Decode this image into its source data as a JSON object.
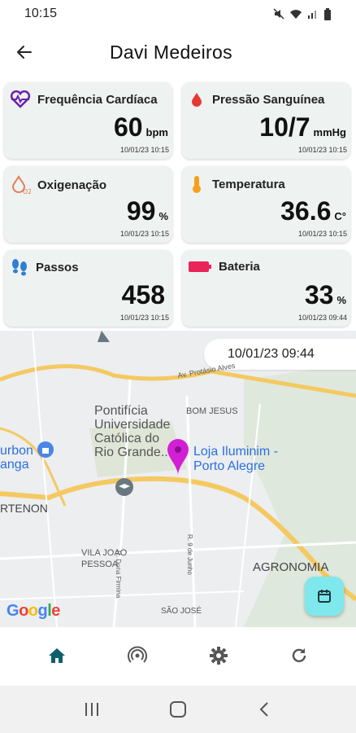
{
  "status_bar": {
    "time": "10:15"
  },
  "header": {
    "title": "Davi Medeiros"
  },
  "cards": [
    {
      "label": "Frequência Cardíaca",
      "value": "60",
      "unit": "bpm",
      "timestamp": "10/01/23 10:15",
      "icon": "heart-pulse-icon",
      "icon_color": "#6a1fb0"
    },
    {
      "label": "Pressão Sanguínea",
      "value": "10/7",
      "unit": "mmHg",
      "timestamp": "10/01/23 10:15",
      "icon": "blood-drop-icon",
      "icon_color": "#e53935"
    },
    {
      "label": "Oxigenação",
      "value": "99",
      "unit": "%",
      "timestamp": "10/01/23 10:15",
      "icon": "oxygen-drop-icon",
      "icon_color": "#e8734a"
    },
    {
      "label": "Temperatura",
      "value": "36.6",
      "unit": "C°",
      "timestamp": "10/01/23 10:15",
      "icon": "thermometer-icon",
      "icon_color": "#f4a01c"
    },
    {
      "label": "Passos",
      "value": "458",
      "unit": "",
      "timestamp": "10/01/23 10:15",
      "icon": "footsteps-icon",
      "icon_color": "#2f7fd1"
    },
    {
      "label": "Bateria",
      "value": "33",
      "unit": "%",
      "timestamp": "10/01/23 09:44",
      "icon": "battery-icon",
      "icon_color": "#e8245a"
    }
  ],
  "map": {
    "date_chip": "10/01/23 09:44",
    "place_name": "Loja Iluminim - Porto Alegre",
    "place_line1": "Loja Iluminim -",
    "place_line2": "Porto Alegre",
    "poi_university_1": "Pontifícia",
    "poi_university_2": "Universidade",
    "poi_university_3": "Católica do",
    "poi_university_4": "Rio Grande...",
    "poi_left_1": "urbon",
    "poi_left_2": "anga",
    "neighborhood_bom_jesus": "BOM JESUS",
    "neighborhood_partenon": "RTENON",
    "neighborhood_vila_joao_1": "VILA JOAO",
    "neighborhood_vila_joao_2": "PESSOA",
    "neighborhood_agronomia": "AGRONOMIA",
    "neighborhood_sao_jose": "SÃO JOSÉ",
    "street_protasio": "Av. Protásio Alves",
    "street_dona_firmina": "R. Dona Firmina",
    "street_9_junho": "R. 9 de Junho",
    "attribution": "Google"
  },
  "colors": {
    "nav_active": "#0d5f6b",
    "nav_inactive": "#555555",
    "fab": "#7fe8ec",
    "pin": "#d21fd6"
  }
}
